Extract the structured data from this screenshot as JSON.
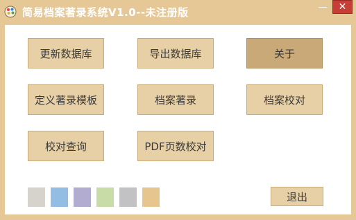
{
  "window": {
    "title": "简易档案著录系统V1.0--未注册版",
    "minimize_label": "—",
    "close_label": "✕"
  },
  "buttons": {
    "update_db": "更新数据库",
    "export_db": "导出数据库",
    "about": "关于",
    "define_template": "定义著录模板",
    "archive_catalog": "档案著录",
    "archive_proofread": "档案校对",
    "proofread_query": "校对查询",
    "pdf_page_check": "PDF页数校对",
    "exit": "退出"
  },
  "theme": {
    "window_bg": "#e6c896",
    "button_bg": "#e8d0a6",
    "active_button_bg": "#caa978",
    "close_bg": "#c73e36"
  },
  "swatches": [
    {
      "name": "gray",
      "color": "#d6d3cd"
    },
    {
      "name": "blue",
      "color": "#93bde3"
    },
    {
      "name": "purple",
      "color": "#b1acd0"
    },
    {
      "name": "green",
      "color": "#c8dca8"
    },
    {
      "name": "silver",
      "color": "#c2c2c4"
    },
    {
      "name": "tan",
      "color": "#e6c58e"
    }
  ]
}
